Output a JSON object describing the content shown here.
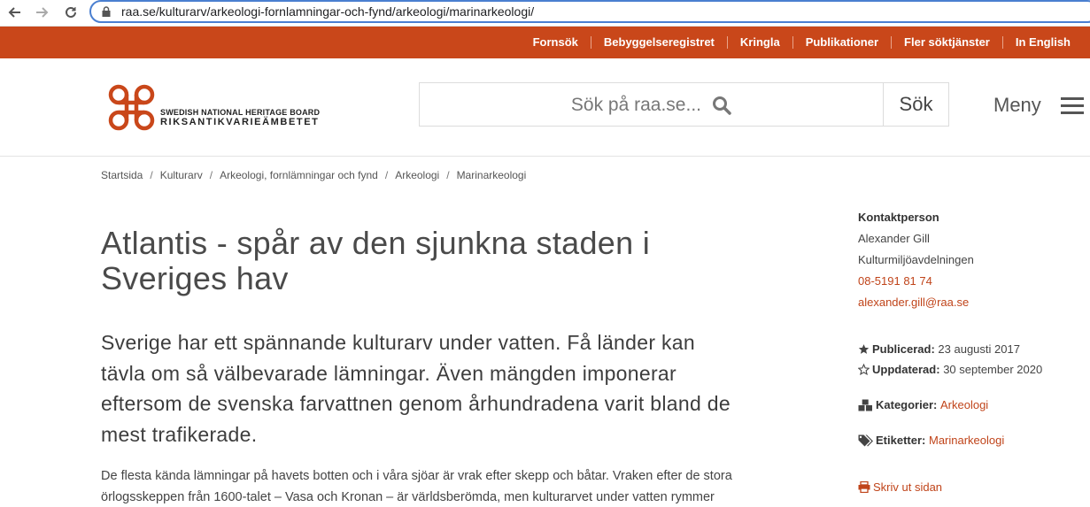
{
  "browser": {
    "url": "raa.se/kulturarv/arkeologi-fornlamningar-och-fynd/arkeologi/marinarkeologi/"
  },
  "topnav": {
    "links": [
      "Fornsök",
      "Bebyggelseregistret",
      "Kringla",
      "Publikationer",
      "Fler söktjänster",
      "In English"
    ]
  },
  "header": {
    "logo_line1": "SWEDISH NATIONAL HERITAGE BOARD",
    "logo_line2": "RIKSANTIKVARIEÄMBETET",
    "search_placeholder": "Sök på raa.se...",
    "search_button": "Sök",
    "menu_label": "Meny"
  },
  "breadcrumb": [
    "Startsida",
    "Kulturarv",
    "Arkeologi, fornlämningar och fynd",
    "Arkeologi",
    "Marinarkeologi"
  ],
  "article": {
    "title_line1": "Atlantis - spår av den sjunkna staden i",
    "title_line2": "Sveriges hav",
    "lead": "Sverige har ett spännande kulturarv under vatten. Få länder kan tävla om så välbevarade lämningar. Även mängden imponerar eftersom de svenska farvattnen genom århundradena varit bland de mest trafikerade.",
    "body": "De flesta kända lämningar på havets botten och i våra sjöar är vrak efter skepp och båtar. Vraken efter de stora örlogsskeppen från 1600-talet – Vasa och Kronan – är världsberömda, men kulturarvet under vatten rymmer"
  },
  "sidebar": {
    "contact_heading": "Kontaktperson",
    "contact_name": "Alexander Gill",
    "contact_dept": "Kulturmiljöavdelningen",
    "contact_phone": "08-5191 81 74",
    "contact_email": "alexander.gill@raa.se",
    "published_label": "Publicerad:",
    "published_date": "23 augusti 2017",
    "updated_label": "Uppdaterad:",
    "updated_date": "30 september 2020",
    "categories_label": "Kategorier:",
    "category": "Arkeologi",
    "tags_label": "Etiketter:",
    "tag": "Marinarkeologi",
    "print_label": "Skriv ut sidan"
  },
  "colors": {
    "brand_orange": "#c9471a",
    "link": "#c0441a"
  }
}
